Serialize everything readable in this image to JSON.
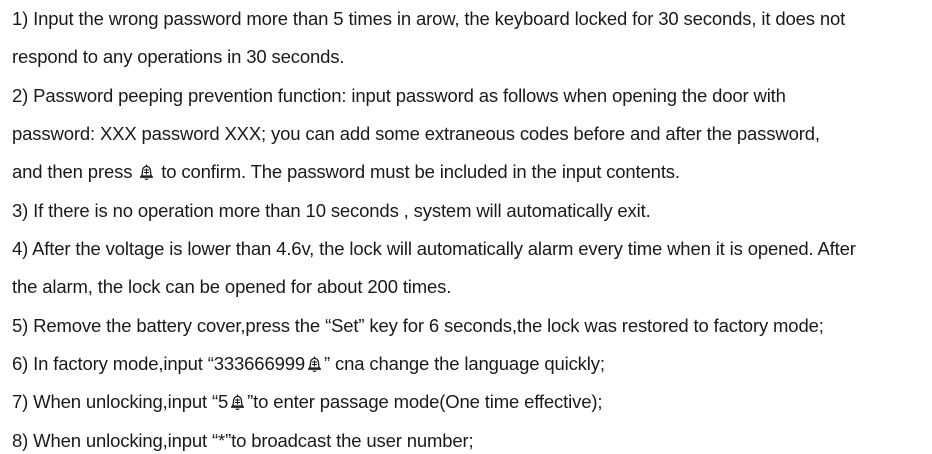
{
  "lines": [
    {
      "text": "1) Input the wrong password more than 5 times in arow, the keyboard locked for 30 seconds, it does not"
    },
    {
      "text": "respond to any operations in 30 seconds."
    },
    {
      "text": "2) Password peeping prevention function: input password as follows when opening the door with"
    },
    {
      "text": "password: XXX password XXX; you can add some extraneous codes before and after the password,"
    },
    {
      "pre": "and then press ",
      "post": " to confirm. The password must be included in the input contents."
    },
    {
      "text": "3) If there is no operation more than 10 seconds , system will automatically exit."
    },
    {
      "text": "4) After the voltage is lower than 4.6v, the lock will automatically alarm every time when it is opened. After"
    },
    {
      "text": "the alarm, the lock can be opened for about 200 times."
    },
    {
      "text": "5) Remove the battery cover,press the “Set” key for 6 seconds,the lock was restored to factory mode;"
    },
    {
      "pre": "6) In factory mode,input “333666999",
      "post": "” cna change the language quickly;"
    },
    {
      "pre": "7) When unlocking,input “5",
      "post": "”to enter passage mode(One time effective);"
    },
    {
      "text": "8) When unlocking,input “*”to broadcast the user number;"
    }
  ],
  "icons": {
    "confirm_key": "bell-key-icon"
  },
  "colors": {
    "text": "#1a1a1a",
    "background": "#ffffff"
  }
}
